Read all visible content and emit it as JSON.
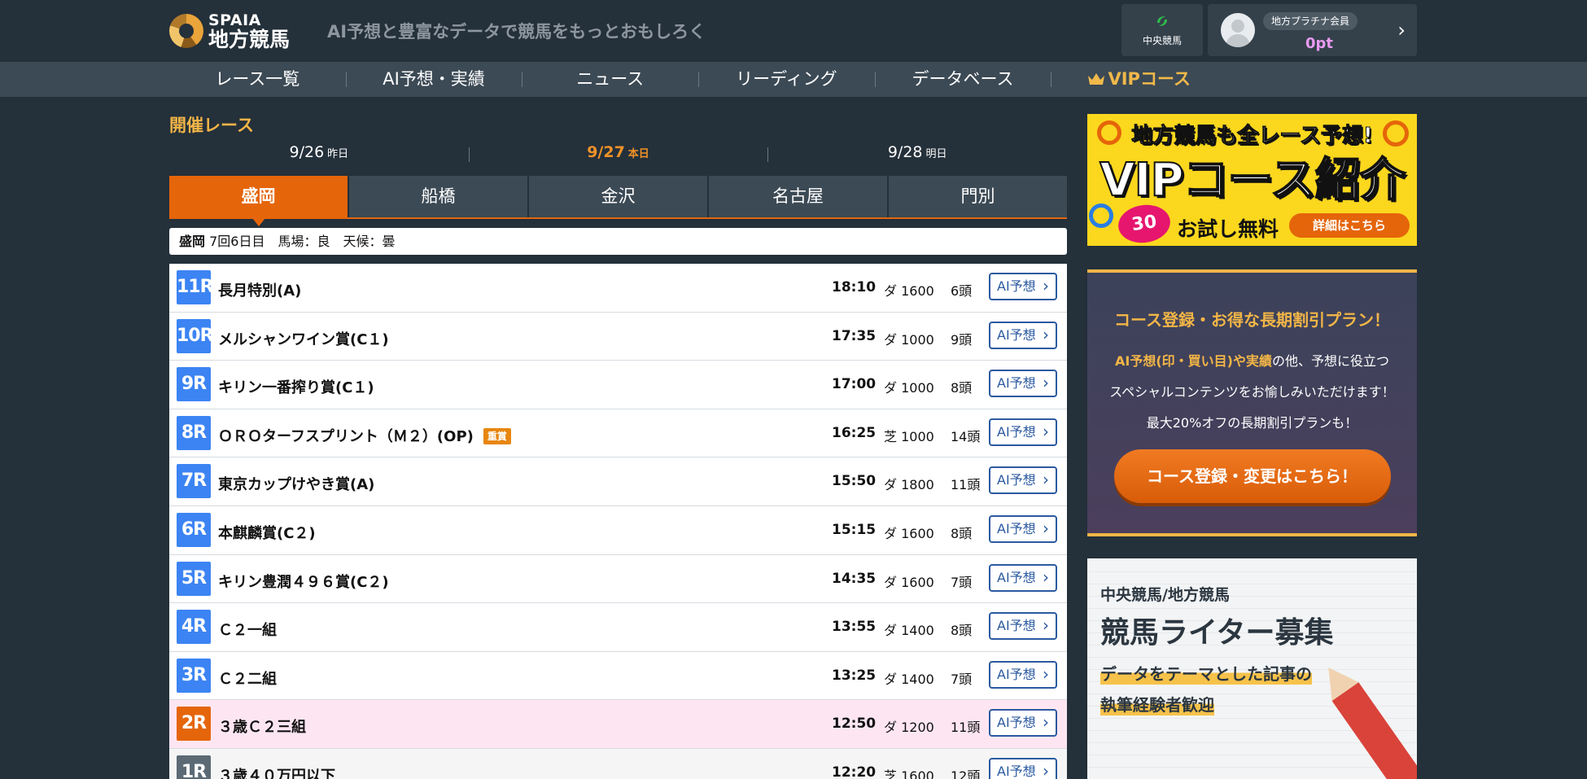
{
  "header": {
    "logo_en": "SPAIA",
    "logo_ja": "地方競馬",
    "tagline": "AI予想と豊富なデータで競馬をもっとおもしろく",
    "central_label": "中央競馬",
    "member_badge": "地方プラチナ会員",
    "member_points": "0pt"
  },
  "nav": [
    {
      "label": "レース一覧"
    },
    {
      "label": "AI予想・実績"
    },
    {
      "label": "ニュース"
    },
    {
      "label": "リーディング"
    },
    {
      "label": "データベース"
    },
    {
      "label": "VIPコース"
    }
  ],
  "main": {
    "section_title": "開催レース",
    "dates": [
      {
        "date": "9/26",
        "suffix": "昨日"
      },
      {
        "date": "9/27",
        "suffix": "本日"
      },
      {
        "date": "9/28",
        "suffix": "明日"
      }
    ],
    "tabs": [
      "盛岡",
      "船橋",
      "金沢",
      "名古屋",
      "門別"
    ],
    "info": {
      "venue": "盛岡",
      "details": "7回6日目　馬場：良　天候：曇"
    },
    "ai_button_label": "AI予想",
    "races": [
      {
        "num": "11R",
        "name": "長月特別(A)",
        "grade": "",
        "time": "18:10",
        "track": "ダ 1600",
        "horses": "6頭"
      },
      {
        "num": "10R",
        "name": "メルシャンワイン賞(C１)",
        "grade": "",
        "time": "17:35",
        "track": "ダ 1000",
        "horses": "9頭"
      },
      {
        "num": "9R",
        "name": "キリン一番搾り賞(C１)",
        "grade": "",
        "time": "17:00",
        "track": "ダ 1000",
        "horses": "8頭"
      },
      {
        "num": "8R",
        "name": "ＯＲＯターフスプリント（Ｍ２）(OP)",
        "grade": "重賞",
        "time": "16:25",
        "track": "芝 1000",
        "horses": "14頭"
      },
      {
        "num": "7R",
        "name": "東京カップけやき賞(A)",
        "grade": "",
        "time": "15:50",
        "track": "ダ 1800",
        "horses": "11頭"
      },
      {
        "num": "6R",
        "name": "本麒麟賞(C２)",
        "grade": "",
        "time": "15:15",
        "track": "ダ 1600",
        "horses": "8頭"
      },
      {
        "num": "5R",
        "name": "キリン豊潤４９６賞(C２)",
        "grade": "",
        "time": "14:35",
        "track": "ダ 1600",
        "horses": "7頭"
      },
      {
        "num": "4R",
        "name": "Ｃ２一組",
        "grade": "",
        "time": "13:55",
        "track": "ダ 1400",
        "horses": "8頭"
      },
      {
        "num": "3R",
        "name": "Ｃ２二組",
        "grade": "",
        "time": "13:25",
        "track": "ダ 1400",
        "horses": "7頭"
      },
      {
        "num": "2R",
        "name": "３歳Ｃ２三組",
        "grade": "",
        "time": "12:50",
        "track": "ダ 1200",
        "horses": "11頭"
      },
      {
        "num": "1R",
        "name": "３歳４０万円以下",
        "grade": "",
        "time": "12:20",
        "track": "芝 1600",
        "horses": "12頭"
      }
    ]
  },
  "sidebar": {
    "vip_banner": {
      "top": "地方競馬も全レース予想!",
      "main": "VIPコース紹介",
      "badge": "30",
      "free": "お試し無料",
      "detail": "詳細はこちら"
    },
    "course_banner": {
      "title": "コース登録・お得な長期割引プラン！",
      "text1_hl": "AI予想(印・買い目)や実績",
      "text1_rest": "の他、予想に役立つ",
      "text2": "スペシャルコンテンツをお愉しみいただけます！",
      "text3": "最大20%オフの長期割引プランも！",
      "button": "コース登録・変更はこちら！"
    },
    "writer_banner": {
      "sub": "中央競馬/地方競馬",
      "title": "競馬ライター募集",
      "line1": "データをテーマとした記事の",
      "line2": "執筆経験者歓迎"
    }
  },
  "colors": {
    "accent": "#e5650a",
    "gold": "#f2b547",
    "race_blue": "#3c84f3",
    "background": "#24303a"
  }
}
